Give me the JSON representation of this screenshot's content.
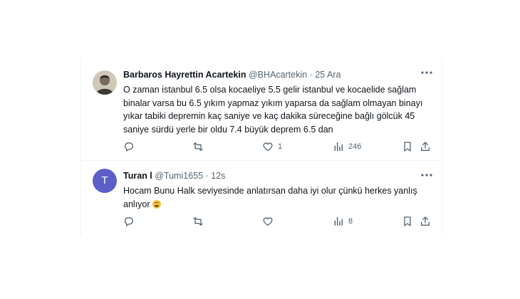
{
  "tweets": [
    {
      "name": "Barbaros Hayrettin Acartekin",
      "handle": "@BHAcartekin",
      "separator": "·",
      "time": "25 Ara",
      "text": "O zaman istanbul 6.5 olsa kocaeliye 5.5 gelir istanbul ve kocaelide sağlam binalar varsa bu 6.5 yıkım yapmaz yıkım yaparsa da sağlam olmayan binayı yıkar tabiki depremin kaç saniye ve kaç dakika süreceğine bağlı gölcük 45 saniye sürdü yerle bir oldu 7.4 büyük deprem 6.5 dan",
      "avatar_letter": "",
      "reply_count": "",
      "retweet_count": "",
      "like_count": "1",
      "view_count": "246"
    },
    {
      "name": "Turan l",
      "handle": "@Tumi1655",
      "separator": "·",
      "time": "12s",
      "text": "Hocam Bunu Halk seviyesinde anlatırsan daha iyi olur çünkü herkes yanlış anlıyor",
      "emoji": "laughing-tears-emoji",
      "avatar_letter": "T",
      "reply_count": "",
      "retweet_count": "",
      "like_count": "",
      "view_count": "8"
    }
  ],
  "icons": {
    "reply": "reply-icon",
    "retweet": "retweet-icon",
    "like": "like-icon",
    "views": "views-icon",
    "bookmark": "bookmark-icon",
    "share": "share-icon",
    "more": "more-icon"
  },
  "colors": {
    "text": "#0f1419",
    "muted": "#536471",
    "divider": "#eff3f4",
    "avatar_t": "#5b5fc7"
  }
}
